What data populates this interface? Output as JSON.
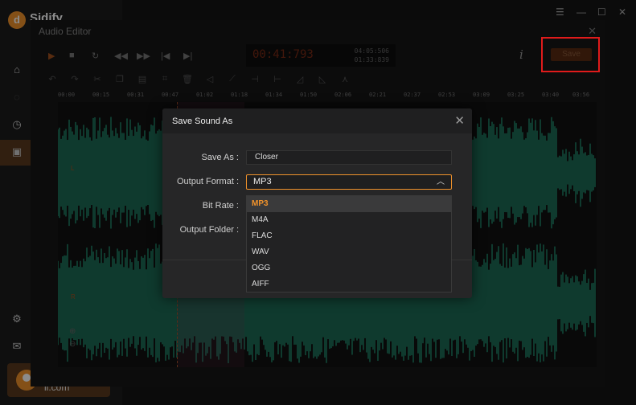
{
  "app": {
    "brand": "Sidify",
    "logo_glyph": "d",
    "account_text": "il.com"
  },
  "window_controls": [
    "☰",
    "—",
    "☐",
    "✕"
  ],
  "editor": {
    "title": "Audio Editor",
    "time_main": "00:41:793",
    "time_total": "04:05:506",
    "time_selection": "01:33:839",
    "save_label": "Save",
    "ruler_ticks": [
      "00:00",
      "00:15",
      "00:31",
      "00:47",
      "01:02",
      "01:18",
      "01:34",
      "01:50",
      "02:06",
      "02:21",
      "02:37",
      "02:53",
      "03:09",
      "03:25",
      "03:40",
      "03:56"
    ],
    "channel_left": "L",
    "channel_right": "R"
  },
  "dialog": {
    "title": "Save Sound As",
    "save_as_label": "Save As :",
    "save_as_value": "Closer",
    "output_format_label": "Output Format :",
    "output_format_value": "MP3",
    "bit_rate_label": "Bit Rate :",
    "output_folder_label": "Output Folder :",
    "format_options": [
      "MP3",
      "M4A",
      "FLAC",
      "WAV",
      "OGG",
      "AIFF"
    ]
  },
  "colors": {
    "accent": "#f0922b",
    "waveform": "#1c6a55",
    "highlight_box": "#e01b1b"
  }
}
